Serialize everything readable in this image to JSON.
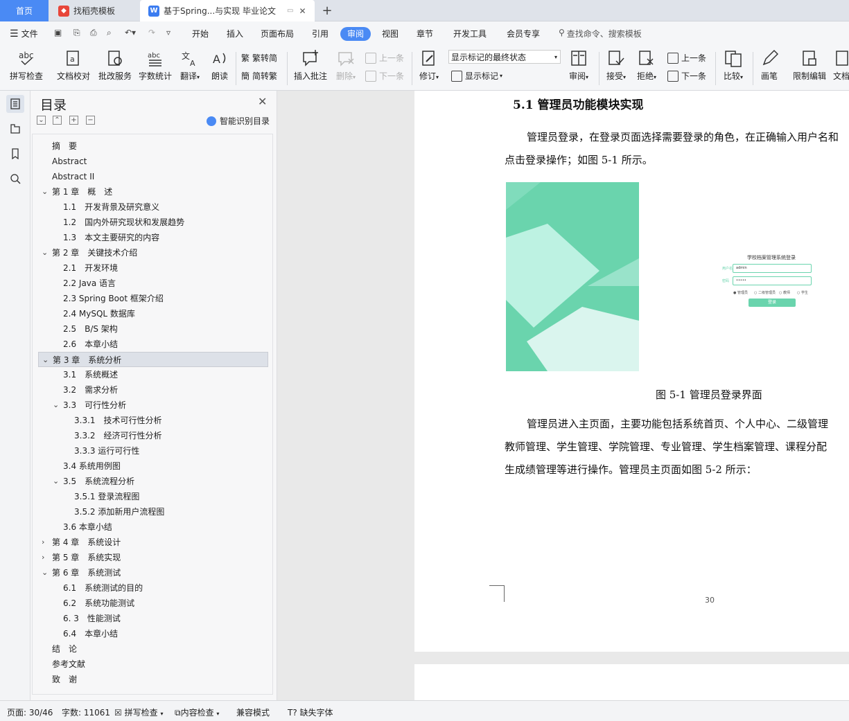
{
  "tabs": {
    "home": "首页",
    "template": "找稻壳模板",
    "document": "基于Spring...与实现 毕业论文",
    "add": "+"
  },
  "menu": {
    "file": "文件",
    "items": [
      "开始",
      "插入",
      "页面布局",
      "引用",
      "审阅",
      "视图",
      "章节",
      "开发工具",
      "会员专享"
    ],
    "active": "审阅",
    "search_placeholder": "查找命令、搜索模板"
  },
  "ribbon": {
    "spellcheck": "拼写检查",
    "doc_proof": "文档校对",
    "review_service": "批改服务",
    "word_count": "字数统计",
    "translate": "翻译",
    "read_aloud": "朗读",
    "to_traditional": "繁转简",
    "to_simplified": "简转繁",
    "insert_comment": "插入批注",
    "delete": "删除",
    "prev": "上一条",
    "next": "下一条",
    "revise": "修订",
    "markup_state": "显示标记的最终状态",
    "show_markup": "显示标记",
    "review": "审阅",
    "accept": "接受",
    "reject": "拒绝",
    "prev2": "上一条",
    "next2": "下一条",
    "compare": "比较",
    "pen": "画笔",
    "restrict_edit": "限制编辑",
    "doc_more": "文档"
  },
  "toc": {
    "title": "目录",
    "smart": "智能识别目录",
    "items": [
      {
        "text": "摘　要",
        "level": 0,
        "chev": ""
      },
      {
        "text": "Abstract",
        "level": 0,
        "chev": ""
      },
      {
        "text": "Abstract II",
        "level": 0,
        "chev": ""
      },
      {
        "text": "第 1 章　概　述",
        "level": 0,
        "chev": "down"
      },
      {
        "text": "1.1　开发背景及研究意义",
        "level": 1,
        "chev": ""
      },
      {
        "text": "1.2　国内外研究现状和发展趋势",
        "level": 1,
        "chev": ""
      },
      {
        "text": "1.3　本文主要研究的内容",
        "level": 1,
        "chev": ""
      },
      {
        "text": "第 2 章　关键技术介绍",
        "level": 0,
        "chev": "down"
      },
      {
        "text": "2.1　开发环境",
        "level": 1,
        "chev": ""
      },
      {
        "text": "2.2 Java 语言",
        "level": 1,
        "chev": ""
      },
      {
        "text": "2.3 Spring Boot 框架介绍",
        "level": 1,
        "chev": ""
      },
      {
        "text": "2.4 MySQL 数据库",
        "level": 1,
        "chev": ""
      },
      {
        "text": "2.5　B/S 架构",
        "level": 1,
        "chev": ""
      },
      {
        "text": "2.6　本章小结",
        "level": 1,
        "chev": ""
      },
      {
        "text": "第 3 章　系统分析",
        "level": 0,
        "chev": "down",
        "selected": true
      },
      {
        "text": "3.1　系统概述",
        "level": 1,
        "chev": ""
      },
      {
        "text": "3.2　需求分析",
        "level": 1,
        "chev": ""
      },
      {
        "text": "3.3　可行性分析",
        "level": 1,
        "chev": "down"
      },
      {
        "text": "3.3.1　技术可行性分析",
        "level": 2,
        "chev": ""
      },
      {
        "text": "3.3.2　经济可行性分析",
        "level": 2,
        "chev": ""
      },
      {
        "text": "3.3.3 运行可行性",
        "level": 2,
        "chev": ""
      },
      {
        "text": "3.4 系统用例图",
        "level": 1,
        "chev": ""
      },
      {
        "text": "3.5　系统流程分析",
        "level": 1,
        "chev": "down"
      },
      {
        "text": "3.5.1 登录流程图",
        "level": 2,
        "chev": ""
      },
      {
        "text": "3.5.2 添加新用户流程图",
        "level": 2,
        "chev": ""
      },
      {
        "text": "3.6 本章小结",
        "level": 1,
        "chev": ""
      },
      {
        "text": "第 4 章　系统设计",
        "level": 0,
        "chev": "right"
      },
      {
        "text": "第 5 章　系统实现",
        "level": 0,
        "chev": "right"
      },
      {
        "text": "第 6 章　系统测试",
        "level": 0,
        "chev": "down"
      },
      {
        "text": "6.1　系统测试的目的",
        "level": 1,
        "chev": ""
      },
      {
        "text": "6.2　系统功能测试",
        "level": 1,
        "chev": ""
      },
      {
        "text": "6. 3　性能测试",
        "level": 1,
        "chev": ""
      },
      {
        "text": "6.4　本章小结",
        "level": 1,
        "chev": ""
      },
      {
        "text": "结　论",
        "level": 0,
        "chev": ""
      },
      {
        "text": "参考文献",
        "level": 0,
        "chev": ""
      },
      {
        "text": "致　谢",
        "level": 0,
        "chev": ""
      }
    ]
  },
  "document": {
    "heading": "5.1 管理员功能模块实现",
    "p1_line1": "管理员登录，在登录页面选择需要登录的角色，在正确输入用户名和",
    "p1_line2": "点击登录操作；如图 5-1 所示。",
    "caption": "图 5-1 管理员登录界面",
    "p2_line1": "管理员进入主页面，主要功能包括系统首页、个人中心、二级管理",
    "p2_line2": "教师管理、学生管理、学院管理、专业管理、学生档案管理、课程分配",
    "p2_line3": "生成绩管理等进行操作。管理员主页面如图 5-2 所示：",
    "page_number": "30",
    "login": {
      "title": "学校档案管理系统登录",
      "user_label": "用户名",
      "user_value": "admin",
      "pass_label": "密码",
      "pass_value": "•••••",
      "roles": [
        "管理员",
        "二级管理员",
        "教师",
        "学生"
      ],
      "button": "登录"
    }
  },
  "status": {
    "page": "页面: 30/46",
    "words": "字数: 11061",
    "spell": "拼写检查",
    "content": "内容检查",
    "compat": "兼容模式",
    "missing_font": "缺失字体"
  },
  "colors": {
    "accent": "#4a8af4",
    "figure_green": "#6ad4ad"
  }
}
